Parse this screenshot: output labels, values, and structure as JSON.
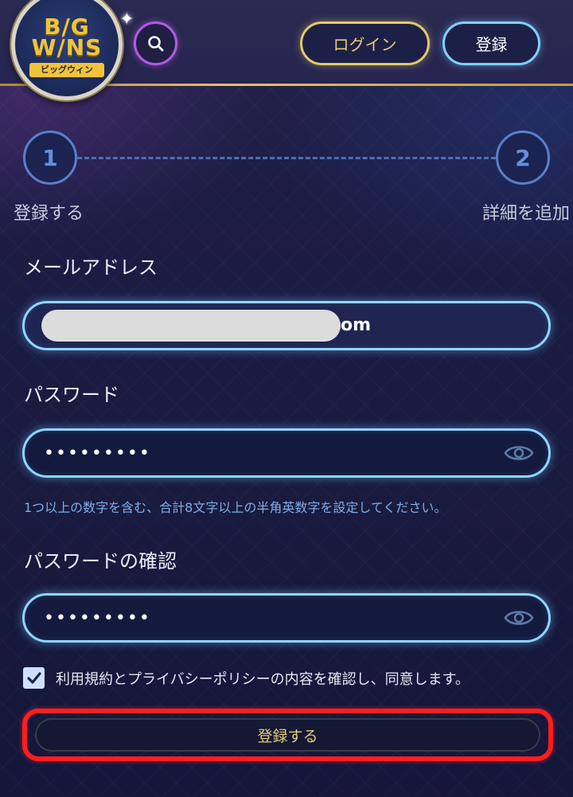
{
  "header": {
    "logo_text": "B/G W/NS",
    "logo_sub": "ビッグウィン",
    "login_label": "ログイン",
    "register_label": "登録"
  },
  "stepper": {
    "steps": [
      {
        "number": "1",
        "label": "登録する"
      },
      {
        "number": "2",
        "label": "詳細を追加"
      }
    ]
  },
  "form": {
    "email": {
      "label": "メールアドレス",
      "value_visible_tail": "om"
    },
    "password": {
      "label": "パスワード",
      "value": "•••••••••",
      "hint": "1つ以上の数字を含む、合計8文字以上の半角英数字を設定してください。"
    },
    "password_confirm": {
      "label": "パスワードの確認",
      "value": "•••••••••"
    },
    "agree_text": "利用規約とプライバシーポリシーの内容を確認し、同意します。",
    "agree_checked": true,
    "submit_label": "登録する"
  },
  "colors": {
    "accent_gold": "#e3c86a",
    "accent_cyan": "#8fd6ff",
    "highlight_red": "#ff1d1d"
  }
}
